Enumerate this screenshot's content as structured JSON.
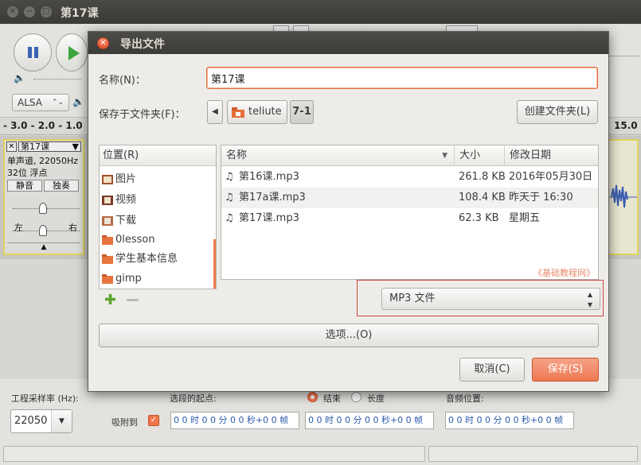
{
  "main_window": {
    "title": "第17课",
    "device": "ALSA",
    "ruler_left": "- 3.0 - 2.0 - 1.0",
    "ruler_right": "15.0",
    "track": {
      "name": "第17课",
      "info_line1": "单声道, 22050Hz",
      "info_line2": "32位 浮点",
      "mute": "静音",
      "solo": "独奏",
      "left": "左",
      "right": "右"
    },
    "bottom": {
      "rate_label": "工程采样率 (Hz):",
      "rate_value": "22050",
      "snap_label": "吸附到",
      "selection_label": "选段的起点:",
      "end_label": "结束",
      "length_label": "长度",
      "audio_pos_label": "音频位置:",
      "time_text": "0 0 时 0 0 分 0 0 秒+0 0 帧"
    }
  },
  "dialog": {
    "title": "导出文件",
    "name_label": "名称(N)：",
    "name_value": "第17课",
    "save_in_label": "保存于文件夹(F)：",
    "path": [
      "teliute",
      "7-1"
    ],
    "create_folder": "创建文件夹(L)",
    "places_header": "位置(R)",
    "places": [
      "图片",
      "视频",
      "下载",
      "0lesson",
      "学生基本信息",
      "gimp"
    ],
    "columns": {
      "name": "名称",
      "size": "大小",
      "date": "修改日期"
    },
    "files": [
      {
        "name": "第16课.mp3",
        "size": "261.8 KB",
        "date": "2016年05月30日"
      },
      {
        "name": "第17a课.mp3",
        "size": "108.4 KB",
        "date": "昨天于 16:30"
      },
      {
        "name": "第17课.mp3",
        "size": "62.3 KB",
        "date": "星期五"
      }
    ],
    "watermark": "《基础教程网》",
    "filetype": "MP3 文件",
    "options": "选项...(O)",
    "cancel": "取消(C)",
    "save": "保存(S)"
  },
  "colors": {
    "accent": "#e9623a",
    "save_button": "#f2876a",
    "highlight_border": "#d0453d"
  }
}
